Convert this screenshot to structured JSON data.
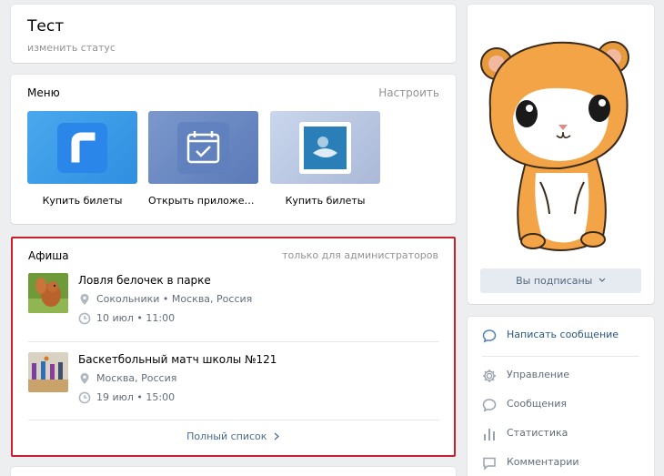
{
  "header": {
    "title": "Тест",
    "status_link": "изменить статус"
  },
  "menu": {
    "title": "Меню",
    "configure": "Настроить",
    "apps": [
      {
        "label": "Купить билеты",
        "icon": "ticket-app-icon"
      },
      {
        "label": "Открыть приложен…",
        "icon": "calendar-check-icon"
      },
      {
        "label": "Купить билеты",
        "icon": "app-logo-icon"
      }
    ]
  },
  "afisha": {
    "title": "Афиша",
    "admin_note": "только для администраторов",
    "events": [
      {
        "name": "Ловля белочек в парке",
        "location": "Сокольники • Москва, Россия",
        "datetime": "10 июл • 11:00",
        "thumb": "squirrel-photo"
      },
      {
        "name": "Баскетбольный матч школы №121",
        "location": "Москва, Россия",
        "datetime": "19 июл • 15:00",
        "thumb": "basketball-photo"
      }
    ],
    "full_list": "Полный список"
  },
  "profile": {
    "avatar": "hamster-avatar",
    "subscribed_button": "Вы подписаны"
  },
  "actions": {
    "write_message": "Написать сообщение",
    "manage": "Управление",
    "messages": "Сообщения",
    "stats": "Статистика",
    "comments": "Комментарии"
  },
  "colors": {
    "accent_link": "#2a5885",
    "highlight_border": "#cc1f2d",
    "page_bg": "#edeef0"
  }
}
